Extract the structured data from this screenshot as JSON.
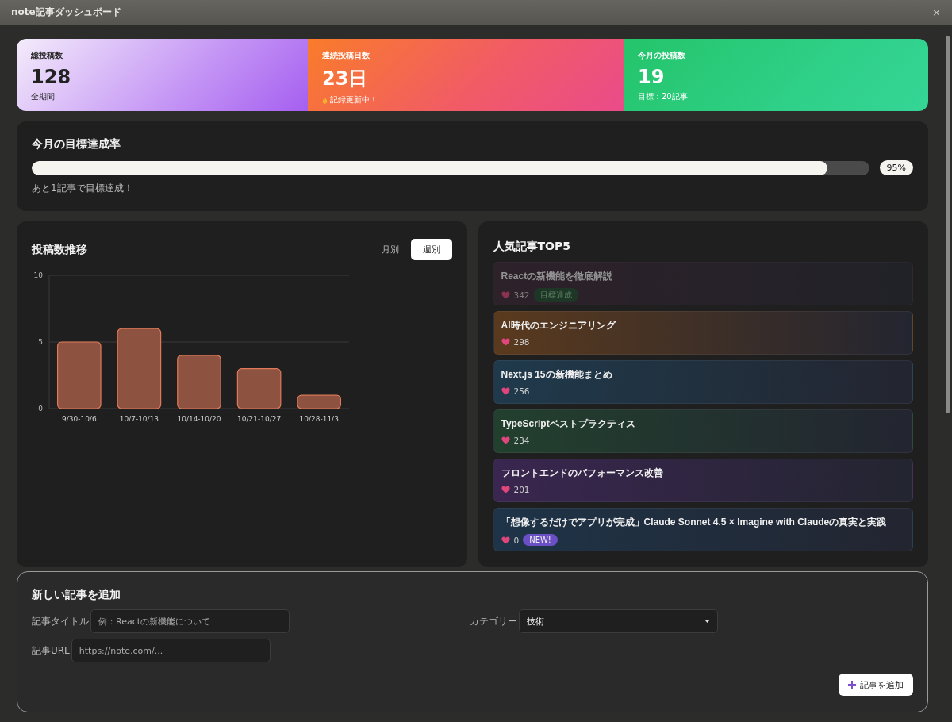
{
  "window": {
    "title": "note記事ダッシュボード",
    "close": "×"
  },
  "stats": [
    {
      "label": "総投稿数",
      "value": "128",
      "note": "全期間",
      "kind": "plain"
    },
    {
      "label": "連続投稿日数",
      "value": "23日",
      "note": "記録更新中！",
      "kind": "flame"
    },
    {
      "label": "今月の投稿数",
      "value": "19",
      "note": "目標：20記事",
      "kind": "plain"
    }
  ],
  "goal": {
    "title": "今月の目標達成率",
    "level": 0.95,
    "reading": "95%",
    "message": "あと1記事で目標達成！"
  },
  "trend": {
    "title": "投稿数推移",
    "toggles": [
      {
        "label": "月別",
        "selected": false
      },
      {
        "label": "週別",
        "selected": true
      }
    ],
    "chart_data": {
      "type": "bar",
      "categories": [
        "9/30-10/6",
        "10/7-10/13",
        "10/14-10/20",
        "10/21-10/27",
        "10/28-11/3"
      ],
      "values": [
        5,
        6,
        4,
        3,
        1
      ],
      "ylim": [
        0,
        10
      ],
      "yticks": [
        0,
        5,
        10
      ]
    }
  },
  "popular": {
    "title": "人気記事TOP5",
    "items": [
      {
        "title": "Reactの新機能を徹底解説",
        "likes": "342",
        "badge": {
          "text": "目標達成",
          "kind": "goal"
        },
        "color": "#3a2433",
        "faded": true
      },
      {
        "title": "AI時代のエンジニアリング",
        "likes": "298",
        "color": "#5a3a1e",
        "faded": false
      },
      {
        "title": "Next.js 15の新機能まとめ",
        "likes": "256",
        "color": "#1f3a4c",
        "faded": false
      },
      {
        "title": "TypeScriptベストプラクティス",
        "likes": "234",
        "color": "#22402e",
        "faded": false
      },
      {
        "title": "フロントエンドのパフォーマンス改善",
        "likes": "201",
        "color": "#3a2650",
        "faded": false
      },
      {
        "title": "「想像するだけでアプリが完成」Claude Sonnet 4.5 × Imagine with Claudeの真実と実践",
        "likes": "0",
        "badge": {
          "text": "NEW!",
          "kind": "new"
        },
        "color": "#1e3448",
        "faded": false
      }
    ]
  },
  "form": {
    "title": "新しい記事を追加",
    "title_label": "記事タイトル",
    "title_placeholder": "例：Reactの新機能について",
    "category_label": "カテゴリー",
    "category_value": "技術",
    "url_label": "記事URL",
    "url_placeholder": "https://note.com/...",
    "submit": "記事を追加"
  }
}
